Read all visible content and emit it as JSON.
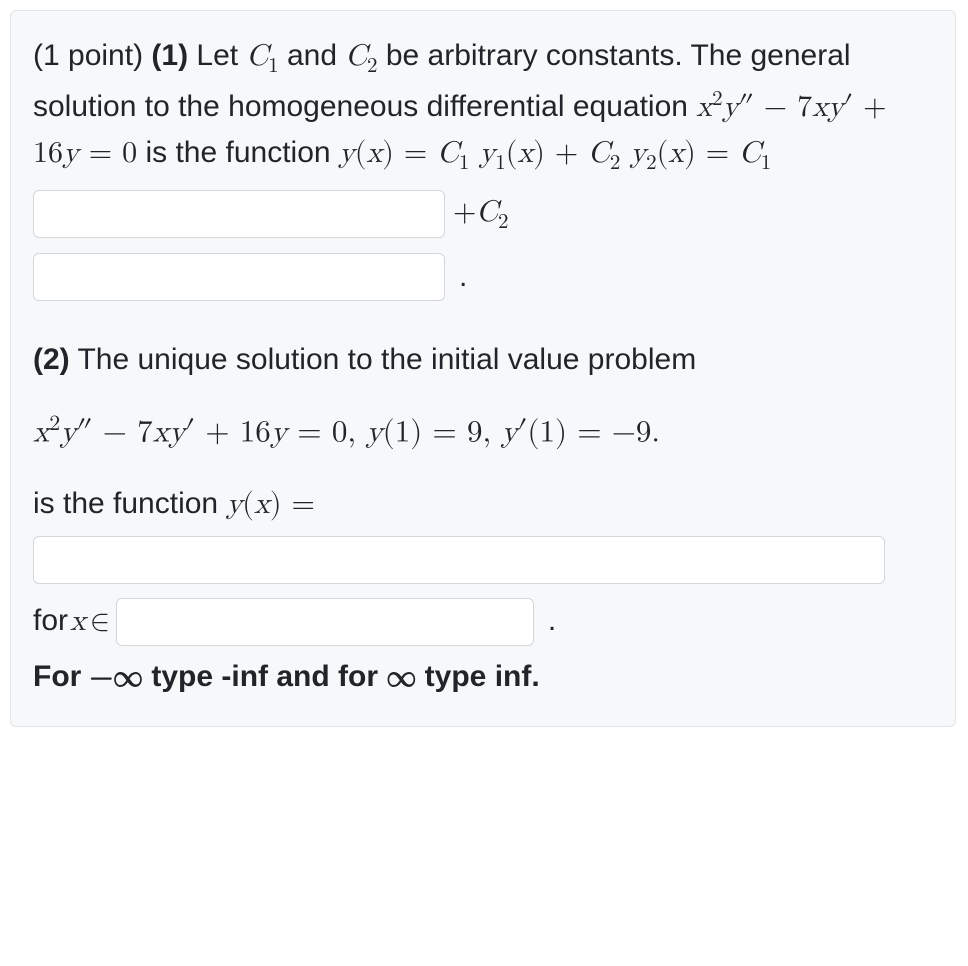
{
  "problem": {
    "points_label": "(1 point) ",
    "part1_num": "(1)",
    "intro_a": " Let ",
    "c1": "C",
    "c1_sub": "1",
    "c2": "C",
    "c2_sub": "2",
    "intro_b": " and ",
    "intro_c": " be arbitrary constants. The general solution to the homogeneous differential equation ",
    "eqn1_pref": "x",
    "eqn1_sq": "2",
    "eqn1_y": "y",
    "eqn1_pp": "″",
    "eqn1_minus": " − 7",
    "eqn1_x2": "x",
    "eqn1_y2": "y",
    "eqn1_p": "′",
    "eqn1_plus": " + 16",
    "eqn1_y3": "y",
    "eqn1_eq": " = 0",
    "intro_d": " is the function ",
    "gen_sol_a": "y",
    "gen_sol_paren_o": "(",
    "gen_sol_x": "x",
    "gen_sol_paren_c": ")",
    "gen_sol_eq": " = ",
    "gs_c1": "C",
    "gs_c1s": "1",
    "gs_sp1": " ",
    "gs_y1": "y",
    "gs_y1s": "1",
    "gs_paren1o": "(",
    "gs_x1": "x",
    "gs_paren1c": ")",
    "gs_plus": " + ",
    "gs_c2": "C",
    "gs_c2s": "2",
    "gs_y2": "y",
    "gs_y2s": "2",
    "gs_paren2o": "(",
    "gs_x2": "x",
    "gs_paren2c": ")",
    "gs_eq2": " = ",
    "gs_c1b": "C",
    "gs_c1bs": "1",
    "plus_c2_a": "+",
    "plus_c2_b": "C",
    "plus_c2_s": "2",
    "dot1": ".",
    "part2_num": "(2)",
    "p2_text": " The unique solution to the initial value problem",
    "ivp_eq": "x",
    "ivp_sq": "2",
    "ivp_y": "y",
    "ivp_pp": "″",
    "ivp_minus": " − 7",
    "ivp_x2": "x",
    "ivp_y2": "y",
    "ivp_p": "′",
    "ivp_plus": " + 16",
    "ivp_y3": "y",
    "ivp_eqz": " = 0,   ",
    "ivp_y4": "y",
    "ivp_po": "(",
    "ivp_one": "1",
    "ivp_pc": ")",
    "ivp_eq9": " = 9,   ",
    "ivp_y5": "y",
    "ivp_pr": "′",
    "ivp_po2": "(",
    "ivp_one2": "1",
    "ivp_pc2": ")",
    "ivp_eqm9": " = −9.",
    "p2_text2_a": "is the function ",
    "p2_yx_y": "y",
    "p2_yx_po": "(",
    "p2_yx_x": "x",
    "p2_yx_pc": ")",
    "p2_yx_eq": " = ",
    "for_x": "for ",
    "for_xv": "x",
    "for_in": " ∈ ",
    "dot2": ".",
    "hint_a": "For ",
    "hint_mi": "−∞",
    "hint_b": " type -inf and for ",
    "hint_pi": "∞",
    "hint_c": " type inf."
  }
}
